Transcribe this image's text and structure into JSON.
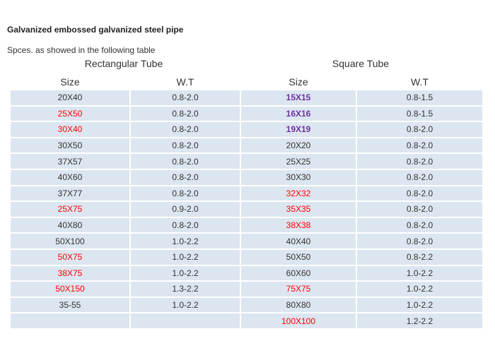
{
  "title": "Galvanized embossed galvanized steel pipe",
  "intro": "Spces. as showed in the following table",
  "colors": {
    "row_background": "#dce6f0",
    "highlight_red": "#ff0000",
    "highlight_purple": "#7030a0"
  },
  "rectangular": {
    "title": "Rectangular Tube",
    "header_size": "Size",
    "header_wt": "W.T",
    "rows": [
      {
        "size": "20X40",
        "wt": "0.8-2.0",
        "style": "normal"
      },
      {
        "size": "25X50",
        "wt": "0.8-2.0",
        "style": "red"
      },
      {
        "size": "30X40",
        "wt": "0.8-2.0",
        "style": "red"
      },
      {
        "size": "30X50",
        "wt": "0.8-2.0",
        "style": "normal"
      },
      {
        "size": "37X57",
        "wt": "0.8-2.0",
        "style": "normal"
      },
      {
        "size": "40X60",
        "wt": "0.8-2.0",
        "style": "normal"
      },
      {
        "size": "37X77",
        "wt": "0.8-2.0",
        "style": "normal"
      },
      {
        "size": "25X75",
        "wt": "0.9-2.0",
        "style": "red"
      },
      {
        "size": "40X80",
        "wt": "0.8-2.0",
        "style": "normal"
      },
      {
        "size": "50X100",
        "wt": "1.0-2.2",
        "style": "normal"
      },
      {
        "size": "50X75",
        "wt": "1.0-2.2",
        "style": "red"
      },
      {
        "size": "38X75",
        "wt": "1.0-2.2",
        "style": "red"
      },
      {
        "size": "50X150",
        "wt": "1.3-2.2",
        "style": "red"
      },
      {
        "size": "35-55",
        "wt": "1.0-2.2",
        "style": "normal"
      },
      {
        "size": "",
        "wt": "",
        "style": "normal"
      }
    ]
  },
  "square": {
    "title": "Square Tube",
    "header_size": "Size",
    "header_wt": "W.T",
    "rows": [
      {
        "size": "15X15",
        "wt": "0.8-1.5",
        "style": "purple"
      },
      {
        "size": "16X16",
        "wt": "0.8-1.5",
        "style": "purple"
      },
      {
        "size": "19X19",
        "wt": "0.8-2.0",
        "style": "purple"
      },
      {
        "size": "20X20",
        "wt": "0.8-2.0",
        "style": "normal"
      },
      {
        "size": "25X25",
        "wt": "0.8-2.0",
        "style": "normal"
      },
      {
        "size": "30X30",
        "wt": "0.8-2.0",
        "style": "normal"
      },
      {
        "size": "32X32",
        "wt": "0.8-2.0",
        "style": "red"
      },
      {
        "size": "35X35",
        "wt": "0.8-2.0",
        "style": "red"
      },
      {
        "size": "38X38",
        "wt": "0.8-2.0",
        "style": "red"
      },
      {
        "size": "40X40",
        "wt": "0.8-2.0",
        "style": "normal"
      },
      {
        "size": "50X50",
        "wt": "0.8-2.2",
        "style": "normal"
      },
      {
        "size": "60X60",
        "wt": "1.0-2.2",
        "style": "normal"
      },
      {
        "size": "75X75",
        "wt": "1.0-2.2",
        "style": "red"
      },
      {
        "size": "80X80",
        "wt": "1.0-2.2",
        "style": "normal"
      },
      {
        "size": "100X100",
        "wt": "1.2-2.2",
        "style": "red"
      }
    ]
  }
}
